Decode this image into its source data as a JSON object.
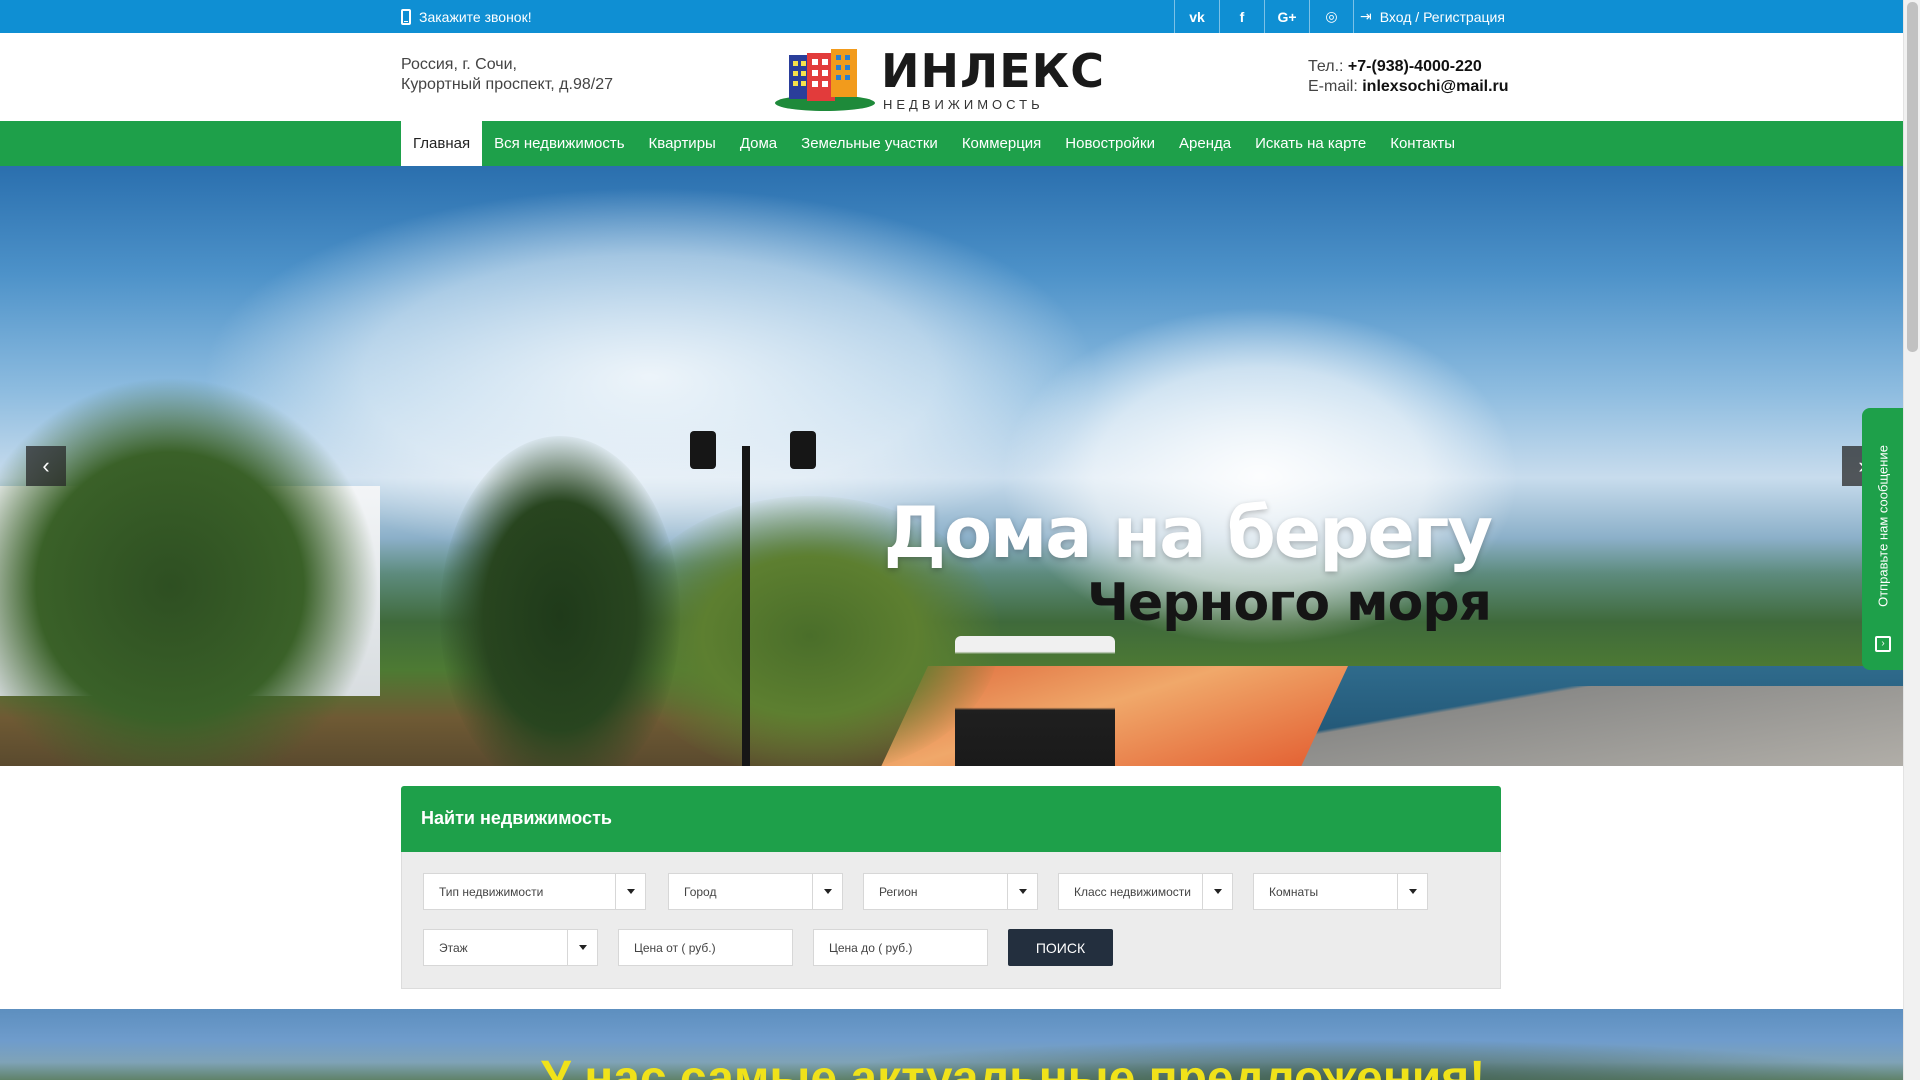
{
  "topbar": {
    "callback_label": "Закажите звонок!",
    "social": [
      "vk",
      "f",
      "G+",
      "◎"
    ],
    "login_label": "Вход / Регистрация",
    "bg_color": "#0f8fd3"
  },
  "header": {
    "address_line1": "Россия, г. Сочи,",
    "address_line2": "Курортный проспект, д.98/27",
    "logo_title": "ИНЛЕКС",
    "logo_subtitle": "НЕДВИЖИМОСТЬ",
    "phone_label": "Тел.:",
    "phone_value": "+7-(938)-4000-220",
    "email_label": "E-mail:",
    "email_value": "inlexsochi@mail.ru"
  },
  "nav": {
    "items": [
      {
        "label": "Главная",
        "active": true
      },
      {
        "label": "Вся недвижимость"
      },
      {
        "label": "Квартиры"
      },
      {
        "label": "Дома"
      },
      {
        "label": "Земельные участки"
      },
      {
        "label": "Коммерция"
      },
      {
        "label": "Новостройки"
      },
      {
        "label": "Аренда"
      },
      {
        "label": "Искать на карте"
      },
      {
        "label": "Контакты"
      }
    ],
    "bg_color": "#1ea04a"
  },
  "hero": {
    "title_line1": "Дома на берегу",
    "title_line2": "Черного моря",
    "prev_icon": "‹",
    "next_icon": "›"
  },
  "feedback_tab": {
    "label": "Отправьте нам сообщение",
    "icon": "›"
  },
  "search": {
    "title": "Найти недвижимость",
    "selects": [
      "Тип недвижимости",
      "Город",
      "Регион",
      "Класс недвижимости",
      "Комнаты",
      "Этаж"
    ],
    "price_from_placeholder": "Цена от ( руб.)",
    "price_to_placeholder": "Цена до ( руб.)",
    "button_label": "ПОИСК"
  },
  "banner": {
    "title": "У нас самые актуальные предложения!"
  }
}
